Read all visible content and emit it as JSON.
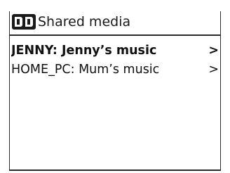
{
  "header": {
    "icon": "media-server-icon",
    "title": "Shared media"
  },
  "list": {
    "items": [
      {
        "label": "JENNY: Jenny’s music",
        "chevron": ">",
        "selected": true
      },
      {
        "label": "HOME_PC: Mum’s music",
        "chevron": ">",
        "selected": false
      }
    ]
  }
}
